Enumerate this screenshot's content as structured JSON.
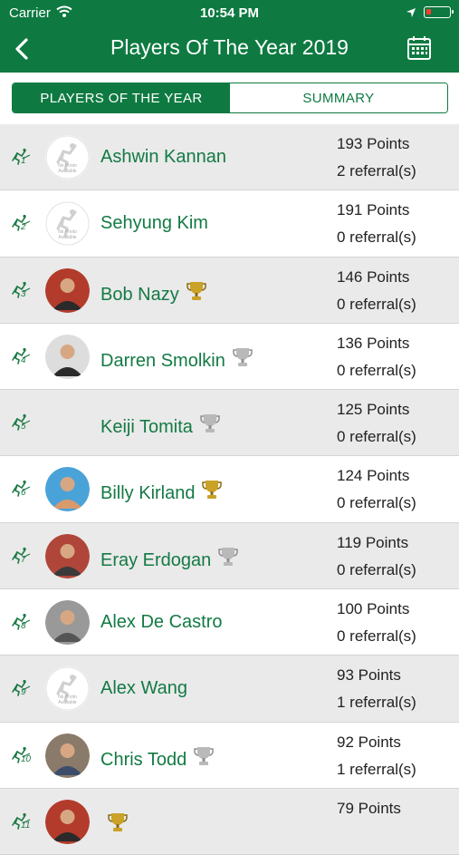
{
  "status_bar": {
    "carrier": "Carrier",
    "time": "10:54 PM"
  },
  "header": {
    "title": "Players Of The Year 2019",
    "back_icon": "chevron-left-icon",
    "calendar_icon": "calendar-icon"
  },
  "tabs": [
    {
      "label": "PLAYERS OF THE YEAR",
      "active": true
    },
    {
      "label": "SUMMARY",
      "active": false
    }
  ],
  "players": [
    {
      "rank": "1",
      "name": "Ashwin Kannan",
      "points": "193 Points",
      "referrals": "2 referral(s)",
      "avatar": "no-photo",
      "trophy": "none"
    },
    {
      "rank": "2",
      "name": "Sehyung Kim",
      "points": "191 Points",
      "referrals": "0 referral(s)",
      "avatar": "no-photo",
      "trophy": "none"
    },
    {
      "rank": "3",
      "name": "Bob Nazy",
      "points": "146 Points",
      "referrals": "0 referral(s)",
      "avatar": "photo",
      "trophy": "gold"
    },
    {
      "rank": "4",
      "name": "Darren Smolkin",
      "points": "136 Points",
      "referrals": "0 referral(s)",
      "avatar": "photo",
      "trophy": "silver"
    },
    {
      "rank": "5",
      "name": "Keiji Tomita",
      "points": "125 Points",
      "referrals": "0 referral(s)",
      "avatar": "none",
      "trophy": "silver"
    },
    {
      "rank": "6",
      "name": "Billy Kirland",
      "points": "124 Points",
      "referrals": "0 referral(s)",
      "avatar": "photo",
      "trophy": "gold"
    },
    {
      "rank": "7",
      "name": "Eray Erdogan",
      "points": "119 Points",
      "referrals": "0 referral(s)",
      "avatar": "photo",
      "trophy": "silver"
    },
    {
      "rank": "8",
      "name": "Alex De Castro",
      "points": "100 Points",
      "referrals": "0 referral(s)",
      "avatar": "photo",
      "trophy": "none"
    },
    {
      "rank": "9",
      "name": "Alex Wang",
      "points": "93 Points",
      "referrals": "1 referral(s)",
      "avatar": "no-photo",
      "trophy": "none"
    },
    {
      "rank": "10",
      "name": "Chris Todd",
      "points": "92 Points",
      "referrals": "1 referral(s)",
      "avatar": "photo",
      "trophy": "silver"
    },
    {
      "rank": "11",
      "name": "",
      "points": "79 Points",
      "referrals": "",
      "avatar": "photo",
      "trophy": "gold"
    }
  ],
  "colors": {
    "primary": "#0e7a41",
    "row_alt": "#eaeaea",
    "name_text": "#137a44",
    "gold": "#c9a227",
    "silver": "#b9b9b9"
  }
}
